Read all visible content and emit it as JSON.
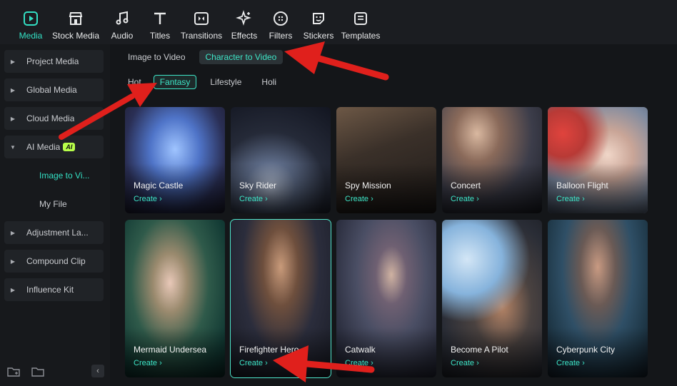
{
  "toolbar": {
    "tools": [
      {
        "label": "Media",
        "icon": "media-icon",
        "active": true
      },
      {
        "label": "Stock Media",
        "icon": "stock-media-icon"
      },
      {
        "label": "Audio",
        "icon": "music-note-icon"
      },
      {
        "label": "Titles",
        "icon": "text-t-icon"
      },
      {
        "label": "Transitions",
        "icon": "transitions-icon"
      },
      {
        "label": "Effects",
        "icon": "sparkle-icon"
      },
      {
        "label": "Filters",
        "icon": "filter-icon"
      },
      {
        "label": "Stickers",
        "icon": "sticker-icon"
      },
      {
        "label": "Templates",
        "icon": "template-icon"
      }
    ]
  },
  "sidebar": {
    "items": [
      {
        "label": "Project Media"
      },
      {
        "label": "Global Media"
      },
      {
        "label": "Cloud Media"
      },
      {
        "label": "AI Media",
        "badge": "AI"
      },
      {
        "label": "Adjustment La..."
      },
      {
        "label": "Compound Clip"
      },
      {
        "label": "Influence Kit"
      }
    ],
    "subitems": [
      {
        "label": "Image to Vi...",
        "active": true
      },
      {
        "label": "My File"
      }
    ],
    "collapse_glyph": "‹"
  },
  "main": {
    "subtabs": [
      {
        "label": "Image to Video"
      },
      {
        "label": "Character to Video",
        "active": true
      }
    ],
    "categories": [
      {
        "label": "Hot"
      },
      {
        "label": "Fantasy",
        "active": true
      },
      {
        "label": "Lifestyle"
      },
      {
        "label": "Holi"
      }
    ],
    "cards": [
      {
        "name": "Magic Castle",
        "create": "Create ›"
      },
      {
        "name": "Sky Rider",
        "create": "Create ›"
      },
      {
        "name": "Spy Mission",
        "create": "Create ›"
      },
      {
        "name": "Concert",
        "create": "Create ›"
      },
      {
        "name": "Balloon Flight",
        "create": "Create ›"
      },
      {
        "name": "Mermaid Undersea",
        "create": "Create ›"
      },
      {
        "name": "Firefighter Hero",
        "create": "Create ›",
        "selected": true
      },
      {
        "name": "Catwalk",
        "create": "Create ›"
      },
      {
        "name": "Become A Pilot",
        "create": "Create ›"
      },
      {
        "name": "Cyberpunk City",
        "create": "Create ›"
      }
    ]
  },
  "colors": {
    "accent": "#3ee6c8",
    "annotation_arrow": "#e0201c",
    "ai_badge": "#b8ff4a"
  }
}
